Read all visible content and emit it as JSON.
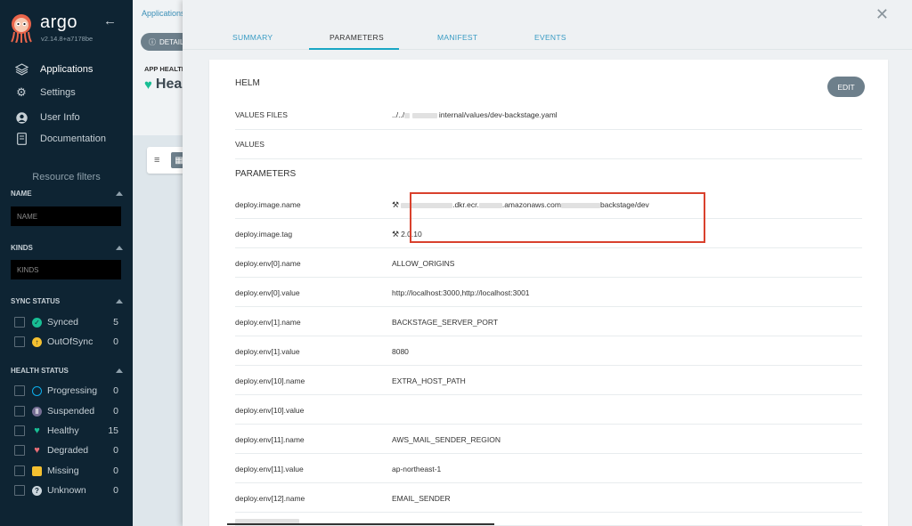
{
  "sidebar": {
    "brand": "argo",
    "version": "v2.14.8+a7178be",
    "nav": [
      {
        "label": "Applications",
        "icon": "layers-icon"
      },
      {
        "label": "Settings",
        "icon": "gear-icon"
      },
      {
        "label": "User Info",
        "icon": "user-icon"
      },
      {
        "label": "Documentation",
        "icon": "book-icon"
      }
    ],
    "resource_filters": "Resource filters",
    "name_section": "NAME",
    "name_placeholder": "NAME",
    "kinds_section": "KINDS",
    "kinds_placeholder": "KINDS",
    "sync_status": "SYNC STATUS",
    "sync_items": [
      {
        "label": "Synced",
        "count": "5",
        "color": "#18be94",
        "icon": "check-circle-icon"
      },
      {
        "label": "OutOfSync",
        "count": "0",
        "color": "#f4c030",
        "icon": "arrow-up-circle-icon"
      }
    ],
    "health_status": "HEALTH STATUS",
    "health_items": [
      {
        "label": "Progressing",
        "count": "0",
        "color": "#0dadea",
        "icon": "circle-notch-icon"
      },
      {
        "label": "Suspended",
        "count": "0",
        "color": "#766f94",
        "icon": "pause-circle-icon"
      },
      {
        "label": "Healthy",
        "count": "15",
        "color": "#18be94",
        "icon": "heart-icon"
      },
      {
        "label": "Degraded",
        "count": "0",
        "color": "#e96d76",
        "icon": "heart-broken-icon"
      },
      {
        "label": "Missing",
        "count": "0",
        "color": "#f4c030",
        "icon": "ghost-icon"
      },
      {
        "label": "Unknown",
        "count": "0",
        "color": "#ccd6dd",
        "icon": "question-circle-icon"
      }
    ]
  },
  "background": {
    "breadcrumb": "Applications",
    "details_button": "DETAILS",
    "app_health_label": "APP HEALTH",
    "health_value": "Healthy"
  },
  "panel": {
    "tabs": [
      "SUMMARY",
      "PARAMETERS",
      "MANIFEST",
      "EVENTS"
    ],
    "active_tab": "PARAMETERS",
    "helm_title": "HELM",
    "edit_label": "EDIT",
    "helm_rows": [
      {
        "key": "VALUES FILES",
        "prefix": "../../",
        "value": "internal/values/dev-backstage.yaml"
      },
      {
        "key": "VALUES",
        "value": ""
      }
    ],
    "parameters_title": "PARAMETERS",
    "image_name": {
      "key": "deploy.image.name",
      "part1": ".dkr.ecr.",
      "part2": ".amazonaws.com",
      "part3": "backstage/dev"
    },
    "image_tag": {
      "key": "deploy.image.tag",
      "value": "2.0.10"
    },
    "param_rows": [
      {
        "key": "deploy.env[0].name",
        "value": "ALLOW_ORIGINS"
      },
      {
        "key": "deploy.env[0].value",
        "value": "http://localhost:3000,http://localhost:3001"
      },
      {
        "key": "deploy.env[1].name",
        "value": "BACKSTAGE_SERVER_PORT"
      },
      {
        "key": "deploy.env[1].value",
        "value": "8080"
      },
      {
        "key": "deploy.env[10].name",
        "value": "EXTRA_HOST_PATH"
      },
      {
        "key": "deploy.env[10].value",
        "value": ""
      },
      {
        "key": "deploy.env[11].name",
        "value": "AWS_MAIL_SENDER_REGION"
      },
      {
        "key": "deploy.env[11].value",
        "value": "ap-northeast-1"
      },
      {
        "key": "deploy.env[12].name",
        "value": "EMAIL_SENDER"
      }
    ]
  }
}
